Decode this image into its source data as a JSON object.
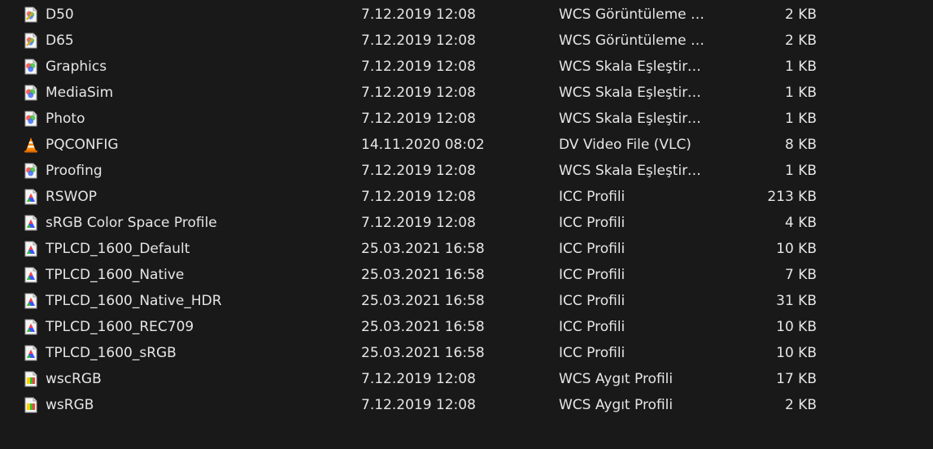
{
  "files": [
    {
      "name": "D50",
      "date": "7.12.2019 12:08",
      "type": "WCS Görüntüleme K...",
      "size": "2 KB",
      "icon": "wcs-viewing-icon"
    },
    {
      "name": "D65",
      "date": "7.12.2019 12:08",
      "type": "WCS Görüntüleme K...",
      "size": "2 KB",
      "icon": "wcs-viewing-icon"
    },
    {
      "name": "Graphics",
      "date": "7.12.2019 12:08",
      "type": "WCS Skala Eşleştirme...",
      "size": "1 KB",
      "icon": "wcs-gamut-icon"
    },
    {
      "name": "MediaSim",
      "date": "7.12.2019 12:08",
      "type": "WCS Skala Eşleştirme...",
      "size": "1 KB",
      "icon": "wcs-gamut-icon"
    },
    {
      "name": "Photo",
      "date": "7.12.2019 12:08",
      "type": "WCS Skala Eşleştirme...",
      "size": "1 KB",
      "icon": "wcs-gamut-icon"
    },
    {
      "name": "PQCONFIG",
      "date": "14.11.2020 08:02",
      "type": "DV Video File (VLC)",
      "size": "8 KB",
      "icon": "vlc-cone-icon"
    },
    {
      "name": "Proofing",
      "date": "7.12.2019 12:08",
      "type": "WCS Skala Eşleştirme...",
      "size": "1 KB",
      "icon": "wcs-gamut-icon"
    },
    {
      "name": "RSWOP",
      "date": "7.12.2019 12:08",
      "type": "ICC Profili",
      "size": "213 KB",
      "icon": "icc-profile-icon"
    },
    {
      "name": "sRGB Color Space Profile",
      "date": "7.12.2019 12:08",
      "type": "ICC Profili",
      "size": "4 KB",
      "icon": "icc-profile-icon"
    },
    {
      "name": "TPLCD_1600_Default",
      "date": "25.03.2021 16:58",
      "type": "ICC Profili",
      "size": "10 KB",
      "icon": "icc-profile-icon"
    },
    {
      "name": "TPLCD_1600_Native",
      "date": "25.03.2021 16:58",
      "type": "ICC Profili",
      "size": "7 KB",
      "icon": "icc-profile-icon"
    },
    {
      "name": "TPLCD_1600_Native_HDR",
      "date": "25.03.2021 16:58",
      "type": "ICC Profili",
      "size": "31 KB",
      "icon": "icc-profile-icon"
    },
    {
      "name": "TPLCD_1600_REC709",
      "date": "25.03.2021 16:58",
      "type": "ICC Profili",
      "size": "10 KB",
      "icon": "icc-profile-icon"
    },
    {
      "name": "TPLCD_1600_sRGB",
      "date": "25.03.2021 16:58",
      "type": "ICC Profili",
      "size": "10 KB",
      "icon": "icc-profile-icon"
    },
    {
      "name": "wscRGB",
      "date": "7.12.2019 12:08",
      "type": "WCS Aygıt Profili",
      "size": "17 KB",
      "icon": "wcs-device-icon"
    },
    {
      "name": "wsRGB",
      "date": "7.12.2019 12:08",
      "type": "WCS Aygıt Profili",
      "size": "2 KB",
      "icon": "wcs-device-icon"
    }
  ],
  "colors": {
    "background": "#191919",
    "text": "#e6e6e6"
  }
}
